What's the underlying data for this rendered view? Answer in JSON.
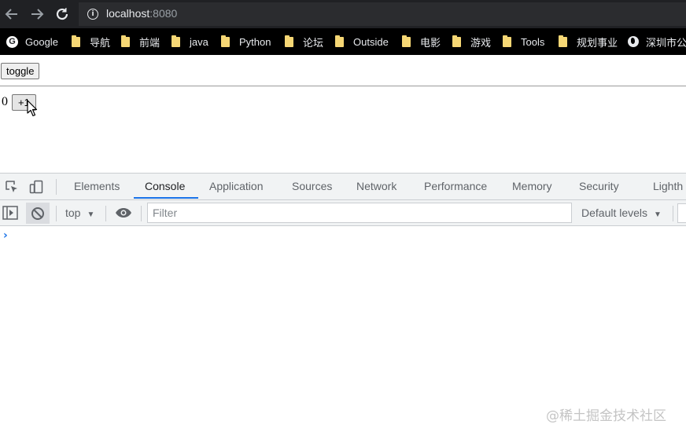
{
  "browser": {
    "url_host": "localhost",
    "url_port": ":8080",
    "icons": {
      "back": "arrow-left-icon",
      "forward": "arrow-right-icon",
      "reload": "reload-icon",
      "info": "info-icon"
    }
  },
  "bookmarks": [
    {
      "label": "Google",
      "icon": "google-icon"
    },
    {
      "label": "导航",
      "icon": "folder-icon"
    },
    {
      "label": "前端",
      "icon": "folder-icon"
    },
    {
      "label": "java",
      "icon": "folder-icon"
    },
    {
      "label": "Python",
      "icon": "folder-icon"
    },
    {
      "label": "论坛",
      "icon": "folder-icon"
    },
    {
      "label": "Outside",
      "icon": "folder-icon"
    },
    {
      "label": "电影",
      "icon": "folder-icon"
    },
    {
      "label": "游戏",
      "icon": "folder-icon"
    },
    {
      "label": "Tools",
      "icon": "folder-icon"
    },
    {
      "label": "规划事业",
      "icon": "folder-icon"
    },
    {
      "label": "深圳市公",
      "icon": "globe-icon"
    }
  ],
  "page": {
    "toggle_label": "toggle",
    "counter_value": "0",
    "increment_label": "+1"
  },
  "devtools": {
    "tabs": [
      "Elements",
      "Console",
      "Application",
      "Sources",
      "Network",
      "Performance",
      "Memory",
      "Security",
      "Lighth"
    ],
    "active_tab": "Console",
    "context": "top",
    "filter_placeholder": "Filter",
    "levels_label": "Default levels",
    "prompt_symbol": "›",
    "accent_color": "#1a73e8"
  },
  "watermark": "@稀土掘金技术社区"
}
